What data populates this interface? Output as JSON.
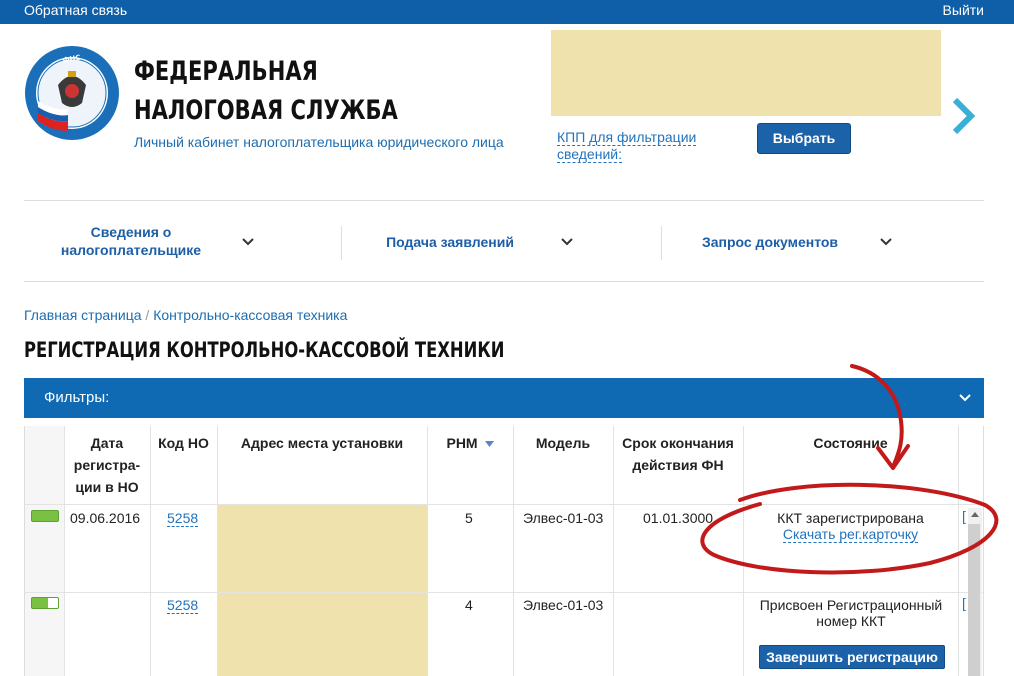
{
  "topbar": {
    "feedback": "Обратная связь",
    "logout": "Выйти"
  },
  "header": {
    "org_line1": "ФЕДЕРАЛЬНАЯ",
    "org_line2": "НАЛОГОВАЯ СЛУЖБА",
    "cabinet": "Личный кабинет налогоплательщика юридического лица",
    "kpp_filter": "КПП для фильтрации сведений:",
    "choose_button": "Выбрать"
  },
  "nav": [
    {
      "label": "Сведения о налогоплательщике"
    },
    {
      "label": "Подача заявлений"
    },
    {
      "label": "Запрос документов"
    }
  ],
  "breadcrumb": {
    "home": "Главная страница",
    "separator": "/",
    "current": "Контрольно-кассовая техника"
  },
  "page_title": "РЕГИСТРАЦИЯ КОНТРОЛЬНО-КАССОВОЙ ТЕХНИКИ",
  "filters": {
    "label": "Фильтры:"
  },
  "table": {
    "headers": {
      "reg_date": "Дата регистра- ции в НО",
      "code_no": "Код НО",
      "address": "Адрес места установки",
      "rnm": "РНМ",
      "model": "Модель",
      "fn_expiry": "Срок окончания действия ФН",
      "status": "Состояние"
    },
    "rows": [
      {
        "indicator": "full",
        "reg_date": "09.06.2016",
        "code_no": "5258",
        "rnm": "5",
        "model": "Элвес-01-03",
        "fn_expiry": "01.01.3000",
        "status": "ККТ зарегистрирована",
        "status_link": "Скачать рег.карточку"
      },
      {
        "indicator": "partial",
        "reg_date": "",
        "code_no": "5258",
        "rnm": "4",
        "model": "Элвес-01-03",
        "fn_expiry": "",
        "status": "Присвоен Регистрационный номер ККТ",
        "action_button": "Завершить регистрацию"
      }
    ]
  },
  "colors": {
    "brand_blue": "#0f5fa8",
    "accent_blue": "#1c62a8",
    "indicator_green": "#7ac143",
    "redacted": "#f0e2ad",
    "annotation_red": "#c21a1a"
  }
}
